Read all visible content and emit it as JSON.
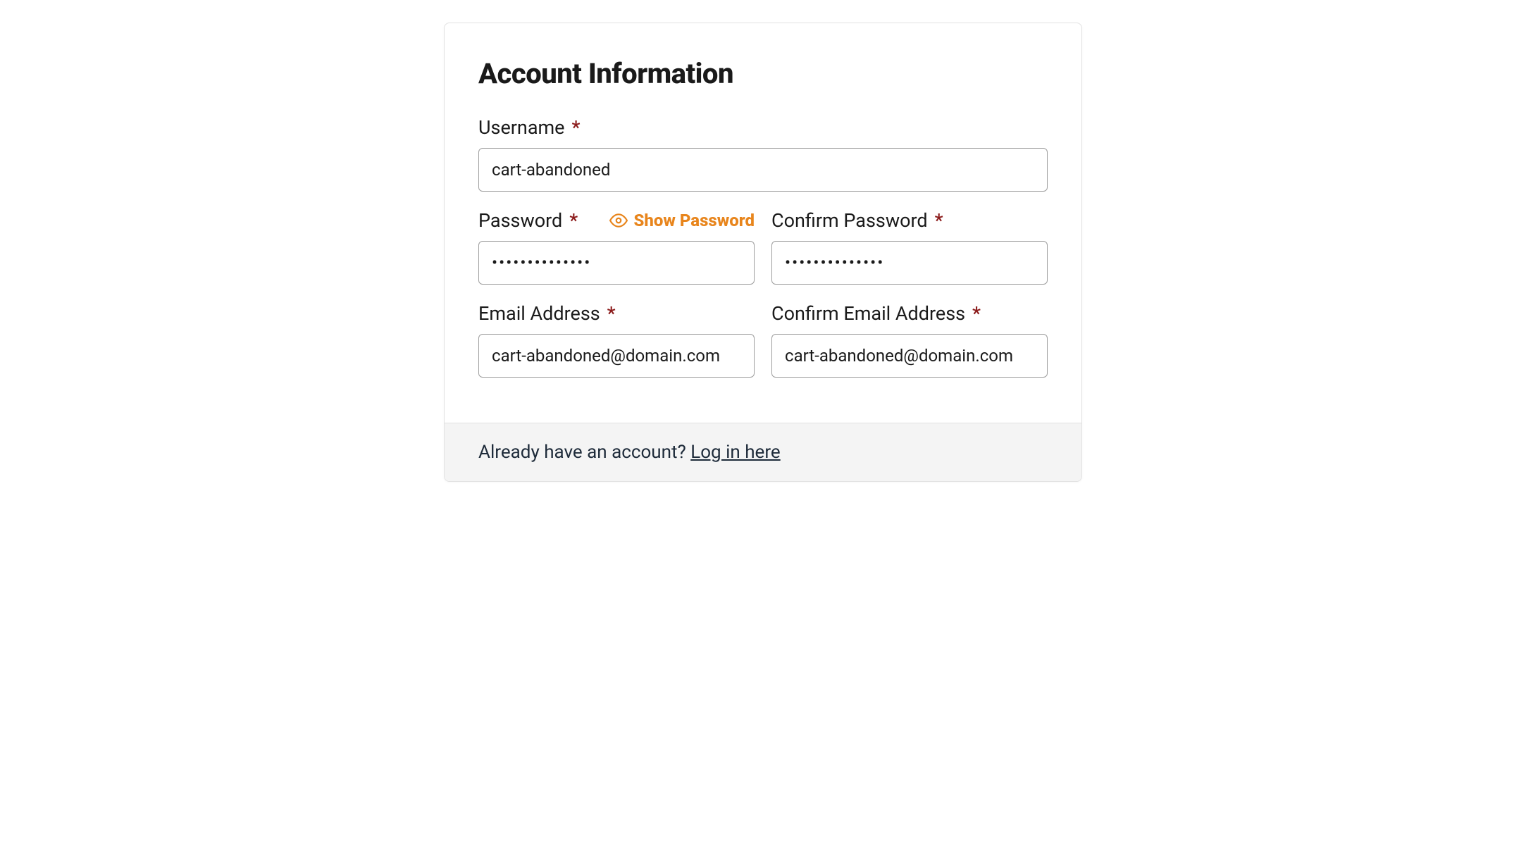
{
  "title": "Account Information",
  "required_marker": "*",
  "fields": {
    "username": {
      "label": "Username",
      "value": "cart-abandoned"
    },
    "password": {
      "label": "Password",
      "value": "••••••••••••••",
      "show_toggle": "Show Password"
    },
    "confirm_password": {
      "label": "Confirm Password",
      "value": "••••••••••••••"
    },
    "email": {
      "label": "Email Address",
      "value": "cart-abandoned@domain.com"
    },
    "confirm_email": {
      "label": "Confirm Email Address",
      "value": "cart-abandoned@domain.com"
    }
  },
  "footer": {
    "prompt": "Already have an account? ",
    "link_text": "Log in here"
  }
}
